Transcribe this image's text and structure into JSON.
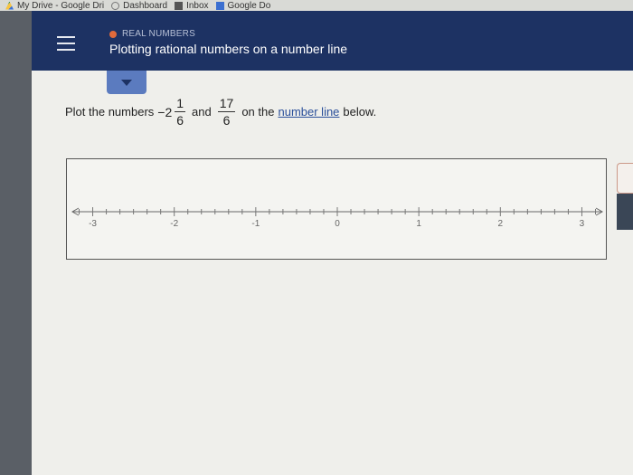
{
  "bookmarks": [
    {
      "label": "My Drive - Google Dri",
      "icon": "google-drive-icon"
    },
    {
      "label": "Dashboard",
      "icon": "dashboard-icon"
    },
    {
      "label": "Inbox",
      "icon": "inbox-icon"
    },
    {
      "label": "Google Do",
      "icon": "google-docs-icon"
    }
  ],
  "header": {
    "topic": "REAL NUMBERS",
    "title": "Plotting rational numbers on a number line"
  },
  "question": {
    "prefix": "Plot the numbers",
    "mixed_sign_whole": "−2",
    "mixed_num": "1",
    "mixed_den": "6",
    "conj": "and",
    "frac_num": "17",
    "frac_den": "6",
    "middle": "on the",
    "link": "number line",
    "suffix": "below."
  },
  "number_line": {
    "min": -3.25,
    "max": 3.25,
    "labels": [
      "-3",
      "-2",
      "-1",
      "0",
      "1",
      "2",
      "3"
    ],
    "label_values": [
      -3,
      -2,
      -1,
      0,
      1,
      2,
      3
    ],
    "subdivisions": 6
  },
  "colors": {
    "header_bg": "#1d3263",
    "accent": "#5b7bbf",
    "topic_dot": "#e06a3b"
  }
}
